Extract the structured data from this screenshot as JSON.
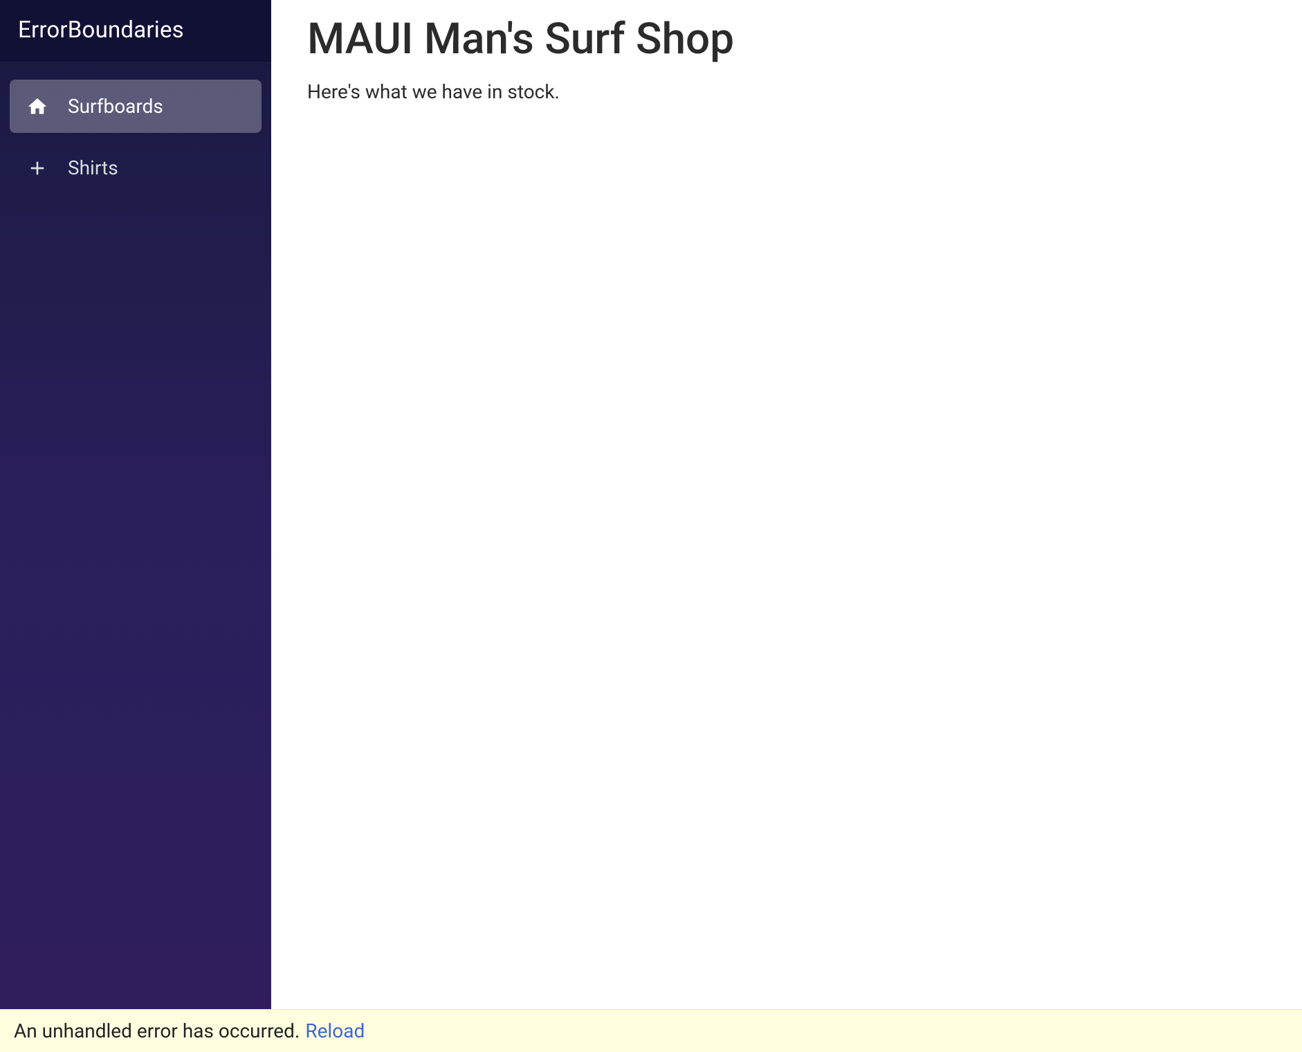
{
  "sidebar": {
    "title": "ErrorBoundaries",
    "items": [
      {
        "label": "Surfboards",
        "icon": "home-icon",
        "active": true
      },
      {
        "label": "Shirts",
        "icon": "plus-icon",
        "active": false
      }
    ]
  },
  "main": {
    "title": "MAUI Man's Surf Shop",
    "subtitle": "Here's what we have in stock."
  },
  "error_bar": {
    "message": "An unhandled error has occurred.",
    "reload_label": "Reload"
  }
}
